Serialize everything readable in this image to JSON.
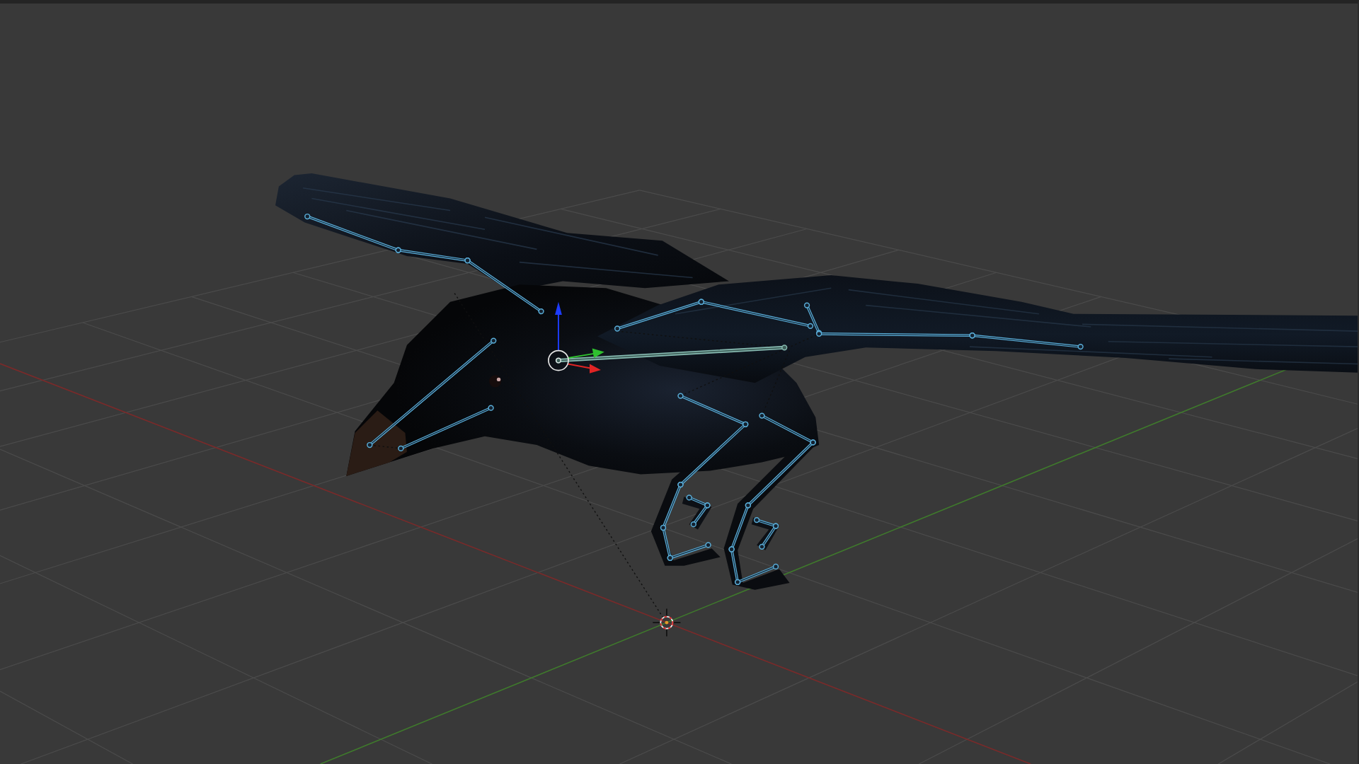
{
  "viewport": {
    "show_floor": true,
    "show_axes": true,
    "show_bones": true,
    "show_gizmo": true,
    "show_cursor": true
  }
}
